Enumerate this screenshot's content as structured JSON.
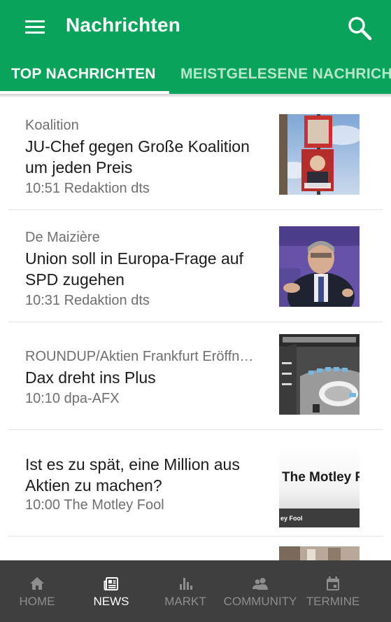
{
  "colors": {
    "brand": "#0aa35c",
    "tab_inactive": "#b8e6cb",
    "bottom_nav": "#3f3f3f",
    "nav_inactive": "#8e8e8e"
  },
  "appbar": {
    "title": "Nachrichten",
    "menu_icon": "hamburger-menu-icon",
    "search_icon": "search-icon"
  },
  "tabs": [
    {
      "label": "TOP NACHRICHTEN",
      "active": true
    },
    {
      "label": "MEISTGELESENE NACHRICHTEN",
      "active": false
    }
  ],
  "news": [
    {
      "kicker": "Koalition",
      "headline": "JU-Chef gegen Große Koalition um jeden Preis",
      "meta": "10:51 Redaktion dts",
      "thumb": "election-poster-photo"
    },
    {
      "kicker": "De Maizière",
      "headline": "Union soll in Europa-Frage auf SPD zugehen",
      "meta": "10:31 Redaktion dts",
      "thumb": "politician-speaking-photo"
    },
    {
      "kicker": "ROUNDUP/Aktien Frankfurt Eröffnung",
      "headline": "Dax dreht ins Plus",
      "meta": "10:10 dpa-AFX",
      "thumb": "stock-exchange-floor-photo"
    },
    {
      "kicker": "",
      "headline": "Ist es zu spät, eine Million aus Aktien zu machen?",
      "meta": "10:00 The Motley Fool",
      "thumb": "motley-fool-logo",
      "thumb_text": "The Motley F",
      "thumb_subtext": "ey Fool"
    }
  ],
  "bottom_nav": [
    {
      "label": "HOME",
      "icon": "home-icon",
      "active": false
    },
    {
      "label": "NEWS",
      "icon": "newspaper-icon",
      "active": true
    },
    {
      "label": "MARKT",
      "icon": "bar-chart-icon",
      "active": false
    },
    {
      "label": "COMMUNITY",
      "icon": "people-icon",
      "active": false
    },
    {
      "label": "TERMINE",
      "icon": "calendar-icon",
      "active": false
    }
  ]
}
